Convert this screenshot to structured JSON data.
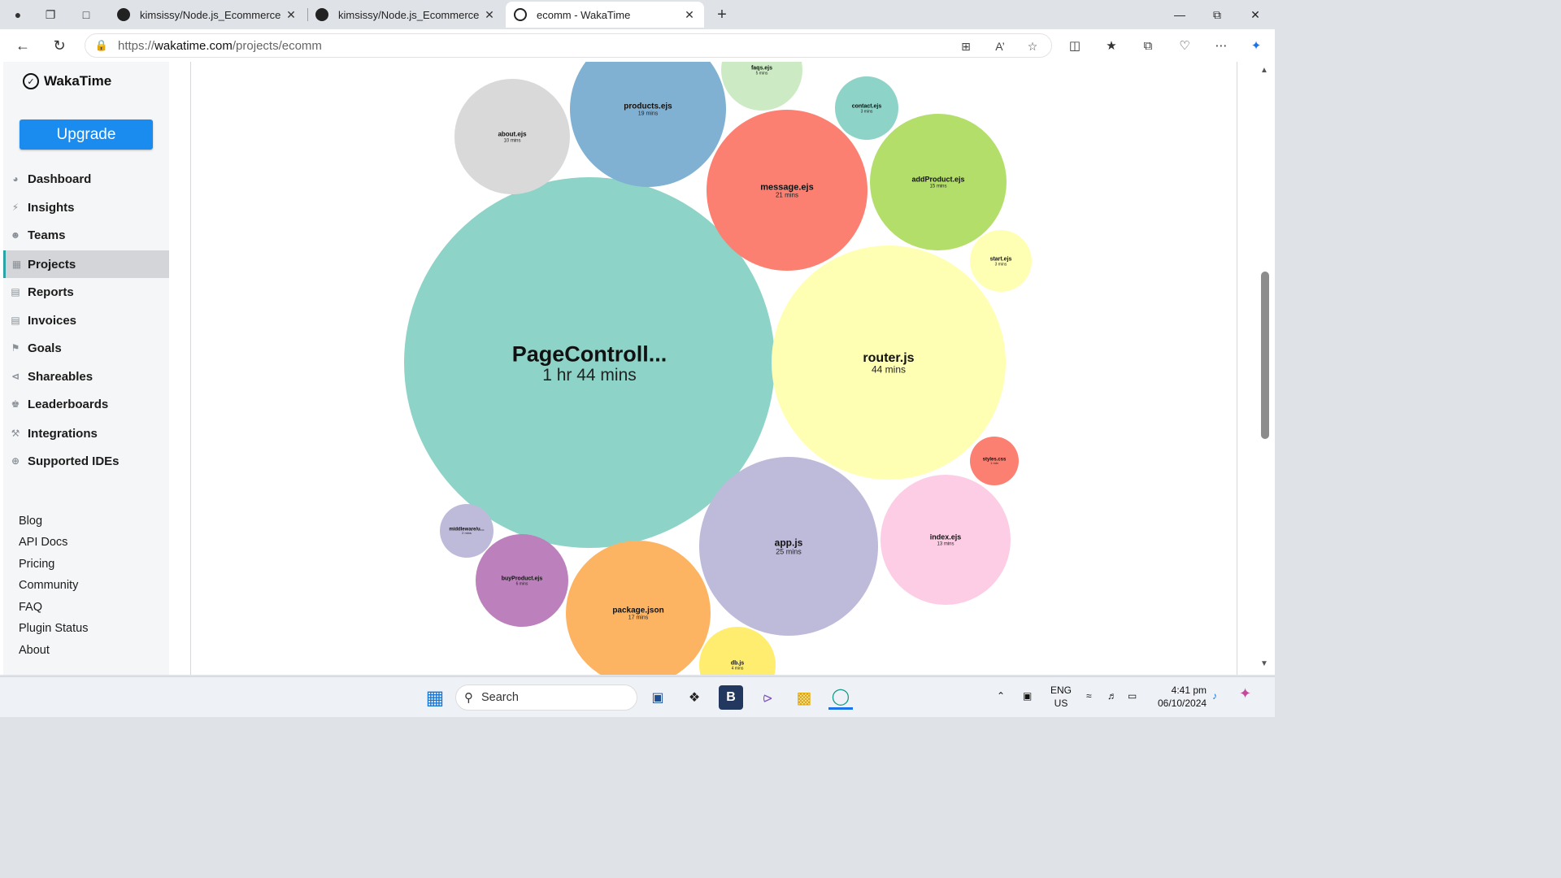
{
  "browser": {
    "tabs": [
      {
        "label": "kimsissy/Node.js_Ecommerce",
        "active": false
      },
      {
        "label": "kimsissy/Node.js_Ecommerce",
        "active": false
      },
      {
        "label": "ecomm - WakaTime",
        "active": true
      }
    ],
    "url_prefix": "https://",
    "url_host": "wakatime.com",
    "url_path": "/projects/ecomm"
  },
  "sidebar": {
    "logo": "WakaTime",
    "upgrade": "Upgrade",
    "menu": [
      {
        "label": "Dashboard",
        "icon": "dashboard-icon",
        "active": false
      },
      {
        "label": "Insights",
        "icon": "bolt-icon",
        "active": false
      },
      {
        "label": "Teams",
        "icon": "users-icon",
        "active": false
      },
      {
        "label": "Projects",
        "icon": "grid-icon",
        "active": true
      },
      {
        "label": "Reports",
        "icon": "pdf-icon",
        "active": false
      },
      {
        "label": "Invoices",
        "icon": "file-icon",
        "active": false
      },
      {
        "label": "Goals",
        "icon": "flag-icon",
        "active": false
      },
      {
        "label": "Shareables",
        "icon": "share-icon",
        "active": false
      },
      {
        "label": "Leaderboards",
        "icon": "trophy-icon",
        "active": false
      },
      {
        "label": "Integrations",
        "icon": "wrench-icon",
        "active": false
      },
      {
        "label": "Supported IDEs",
        "icon": "plus-circle-icon",
        "active": false
      }
    ],
    "footer_links": [
      "Blog",
      "API Docs",
      "Pricing",
      "Community",
      "FAQ",
      "Plugin Status",
      "About"
    ]
  },
  "bubbles": [
    {
      "file": "PageControll...",
      "time": "1 hr 44 mins",
      "minutes": 104,
      "color": "#8ed3c7"
    },
    {
      "file": "router.js",
      "time": "44 mins",
      "minutes": 44,
      "color": "#ffffb3"
    },
    {
      "file": "app.js",
      "time": "25 mins",
      "minutes": 25,
      "color": "#bebada"
    },
    {
      "file": "message.ejs",
      "time": "21 mins",
      "minutes": 21,
      "color": "#fb8072"
    },
    {
      "file": "products.ejs",
      "time": "19 mins",
      "minutes": 19,
      "color": "#80b1d3"
    },
    {
      "file": "package.json",
      "time": "17 mins",
      "minutes": 17,
      "color": "#fdb462"
    },
    {
      "file": "addProduct.ejs",
      "time": "15 mins",
      "minutes": 15,
      "color": "#b3de69"
    },
    {
      "file": "index.ejs",
      "time": "13 mins",
      "minutes": 13,
      "color": "#fccde5"
    },
    {
      "file": "about.ejs",
      "time": "10 mins",
      "minutes": 10,
      "color": "#d9d9d9"
    },
    {
      "file": "buyProduct.ejs",
      "time": "6 mins",
      "minutes": 6,
      "color": "#bc80bd"
    },
    {
      "file": "faqs.ejs",
      "time": "5 mins",
      "minutes": 5,
      "color": "#ccebc5"
    },
    {
      "file": "db.js",
      "time": "4 mins",
      "minutes": 4,
      "color": "#ffed6f"
    },
    {
      "file": "contact.ejs",
      "time": "3 mins",
      "minutes": 3,
      "color": "#8ed3c7"
    },
    {
      "file": "start.ejs",
      "time": "3 mins",
      "minutes": 3,
      "color": "#ffffb3"
    },
    {
      "file": "middleware/u...",
      "time": "2 mins",
      "minutes": 2,
      "color": "#bebada"
    },
    {
      "file": "styles.css",
      "time": "1 min",
      "minutes": 1,
      "color": "#fb8072"
    }
  ],
  "taskbar": {
    "search": "Search",
    "lang1": "ENG",
    "lang2": "US",
    "time": "4:41 pm",
    "date": "06/10/2024"
  }
}
